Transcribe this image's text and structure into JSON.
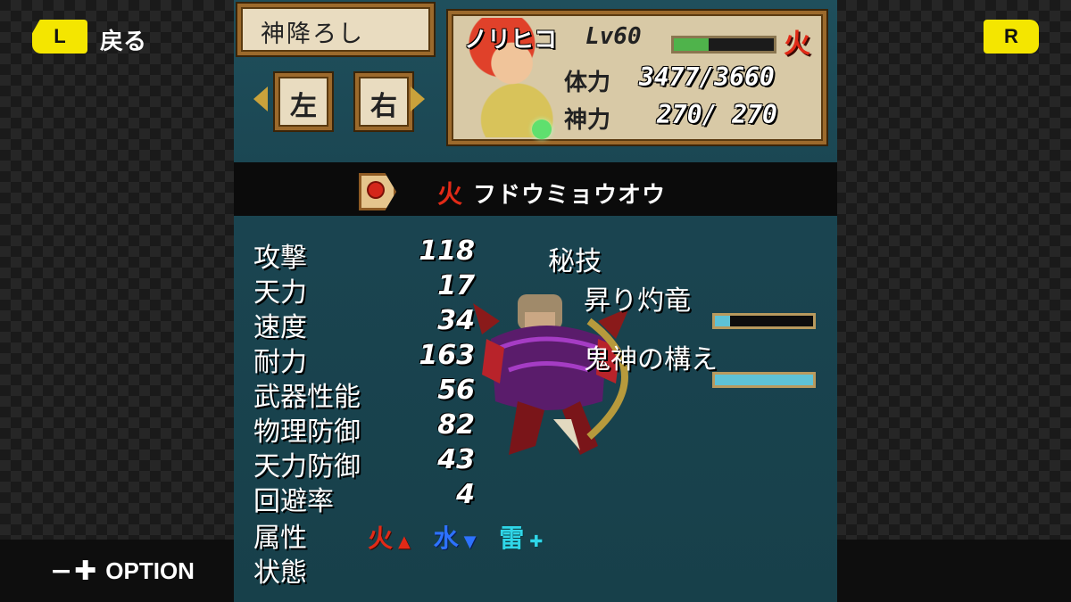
{
  "nav": {
    "l_button": "L",
    "back_label": "戻る",
    "r_button": "R",
    "option_label": "OPTION",
    "option_symbols": "−✚"
  },
  "header": {
    "tech_title": "神降ろし",
    "left_button": "左",
    "right_button": "右"
  },
  "character": {
    "name": "ノリヒコ",
    "level": "Lv60",
    "level_gauge_fraction": 0.35,
    "element": "火",
    "hp_label": "体力",
    "hp_value": "3477/3660",
    "mp_label": "神力",
    "mp_value": "270/ 270"
  },
  "spirit": {
    "element": "火",
    "name": "フドウミョウオウ"
  },
  "stats": [
    {
      "label": "攻撃",
      "value": "118"
    },
    {
      "label": "天力",
      "value": "17"
    },
    {
      "label": "速度",
      "value": "34"
    },
    {
      "label": "耐力",
      "value": "163"
    },
    {
      "label": "武器性能",
      "value": "56"
    },
    {
      "label": "物理防御",
      "value": "82"
    },
    {
      "label": "天力防御",
      "value": "43"
    },
    {
      "label": "回避率",
      "value": "4"
    },
    {
      "label": "属性",
      "value": ""
    },
    {
      "label": "状態",
      "value": ""
    }
  ],
  "attributes": [
    {
      "name": "火",
      "mark": "▲"
    },
    {
      "name": "水",
      "mark": "▼"
    },
    {
      "name": "雷",
      "mark": "✚"
    }
  ],
  "hidden_skills": {
    "label": "秘技",
    "skills": [
      {
        "name": "昇り灼竜",
        "gauge_fraction": 0.15
      },
      {
        "name": "鬼神の構え",
        "gauge_fraction": 1.0
      }
    ]
  },
  "colors": {
    "accent": "#f4e600",
    "fire": "#e22a17",
    "water": "#2d72ff",
    "thunder": "#2fd6e8",
    "hp": "#4fb34b",
    "gauge": "#5ec2d6"
  }
}
